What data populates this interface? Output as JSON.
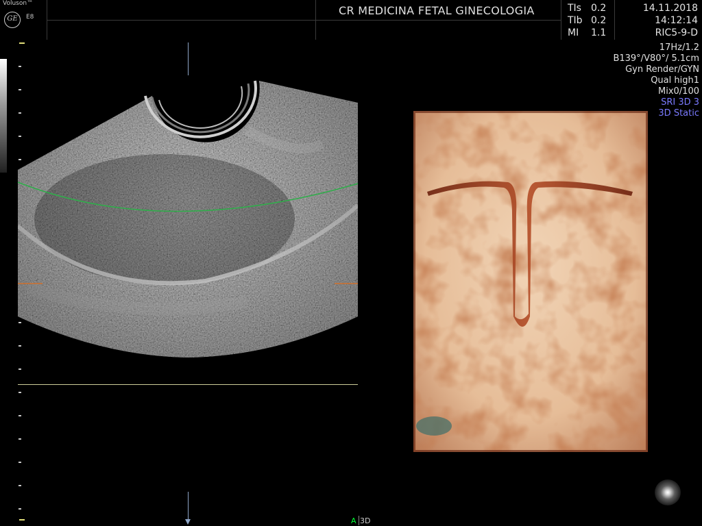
{
  "header": {
    "brand": "Voluson™",
    "logo_text": "GE",
    "model": "E8",
    "clinic": "CR MEDICINA FETAL GINECOLOGIA",
    "tis_label": "TIs",
    "tis_value": "0.2",
    "tib_label": "TIb",
    "tib_value": "0.2",
    "mi_label": "MI",
    "mi_value": "1.1",
    "date": "14.11.2018",
    "time": "14:12:14",
    "probe": "RIC5-9-D"
  },
  "info": {
    "frame_rate": "17Hz/1.2",
    "angles": "B139°/V80°/ 5.1cm",
    "render_mode": "Gyn Render/GYN",
    "quality": "Qual high1",
    "mix": "Mix0/100",
    "sri": "SRI 3D 3",
    "mode": "3D Static"
  },
  "footer": {
    "a_label": "A",
    "view_label": "3D"
  },
  "colors": {
    "accent_blue": "#7a7aff",
    "render_line": "#2fae4a",
    "marker": "#d0702c",
    "tissue": "#e8c6a6"
  }
}
